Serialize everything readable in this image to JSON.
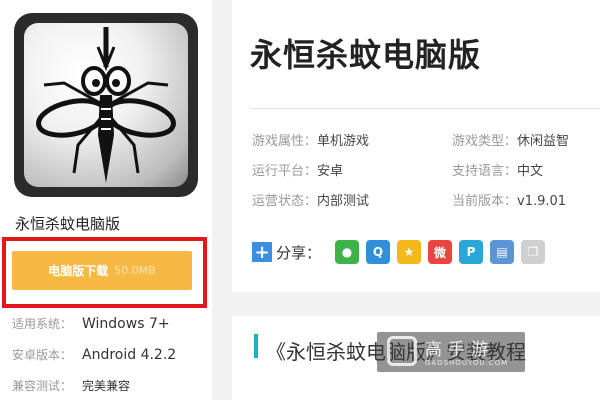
{
  "game": {
    "name": "永恒杀蚊电脑版",
    "title": "永恒杀蚊电脑版"
  },
  "download": {
    "label": "电脑版下载",
    "size": "50.0MB"
  },
  "specs": [
    {
      "key": "适用系统：",
      "value": "Windows 7+"
    },
    {
      "key": "安卓版本：",
      "value": "Android 4.2.2"
    },
    {
      "key": "兼容测试：",
      "value": "完美兼容"
    }
  ],
  "attributes": [
    {
      "key": "游戏属性：",
      "value": "单机游戏"
    },
    {
      "key": "游戏类型：",
      "value": "休闲益智"
    },
    {
      "key": "运行平台：",
      "value": "安卓"
    },
    {
      "key": "支持语言：",
      "value": "中文"
    },
    {
      "key": "运营状态：",
      "value": "内部测试"
    },
    {
      "key": "当前版本：",
      "value": "v1.9.01"
    }
  ],
  "share": {
    "label": "分享：",
    "plus": "+",
    "icons": [
      {
        "name": "wechat-icon",
        "glyph": "●",
        "color": "#3fb34a"
      },
      {
        "name": "qq-icon",
        "glyph": "Q",
        "color": "#2f8fd8"
      },
      {
        "name": "qzone-icon",
        "glyph": "★",
        "color": "#f3b81a"
      },
      {
        "name": "weibo-icon",
        "glyph": "微",
        "color": "#e8473f"
      },
      {
        "name": "tencent-weibo-icon",
        "glyph": "P",
        "color": "#2aa6d9"
      },
      {
        "name": "print-icon",
        "glyph": "▤",
        "color": "#5b95d6"
      },
      {
        "name": "copy-icon",
        "glyph": "❐",
        "color": "#cfcfcf"
      }
    ]
  },
  "tutorial": {
    "heading": "《永恒杀蚊电脑版》安装教程"
  },
  "watermark": {
    "text": "高手游",
    "url": "GAOSHOUYOU.COM"
  },
  "colors": {
    "download_button": "#f7b844",
    "highlight_frame": "#e5161b",
    "accent_bar": "#1ab0c8"
  }
}
